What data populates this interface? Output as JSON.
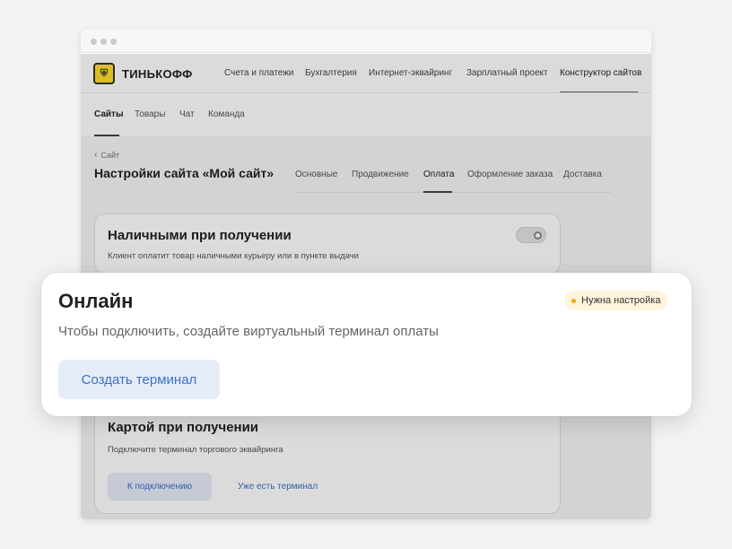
{
  "window": {
    "controls": [
      "close",
      "minimize",
      "maximize"
    ]
  },
  "brand": {
    "name": "ТИНЬКОФФ",
    "emblem_icon": "shield-emblem-icon",
    "color": "#ffdd2d"
  },
  "topnav": {
    "items": [
      {
        "label": "Счета и платежи"
      },
      {
        "label": "Бухгалтерия"
      },
      {
        "label": "Интернет-эквайринг"
      },
      {
        "label": "Зарплатный проект"
      },
      {
        "label": "Конструктор сайтов",
        "active": true
      }
    ]
  },
  "subnav": {
    "items": [
      {
        "label": "Сайты",
        "active": true
      },
      {
        "label": "Товары"
      },
      {
        "label": "Чат"
      },
      {
        "label": "Команда"
      }
    ]
  },
  "page": {
    "back_label": "Сайт",
    "title": "Настройки сайта «Мой сайт»",
    "tabs": [
      {
        "label": "Основные"
      },
      {
        "label": "Продвижение"
      },
      {
        "label": "Оплата",
        "active": true
      },
      {
        "label": "Оформление заказа"
      },
      {
        "label": "Доставка"
      }
    ]
  },
  "cards": {
    "cash": {
      "title": "Наличными при получении",
      "description": "Клиент оплатит товар наличными курьеру или в пункте выдачи",
      "toggle_on": false
    },
    "online": {
      "title": "Онлайн",
      "description": "Чтобы подключить, создайте виртуальный терминал оплаты",
      "badge": "Нужна настройка",
      "badge_color": "#f5a623",
      "button": "Создать терминал"
    },
    "card_on_delivery": {
      "title": "Картой при получении",
      "description": "Подключите терминал торгового эквайринга",
      "primary_button": "К подключению",
      "secondary_link": "Уже есть терминал"
    }
  },
  "colors": {
    "accent": "#3a6fc8",
    "button_bg": "#e6ecf7"
  }
}
